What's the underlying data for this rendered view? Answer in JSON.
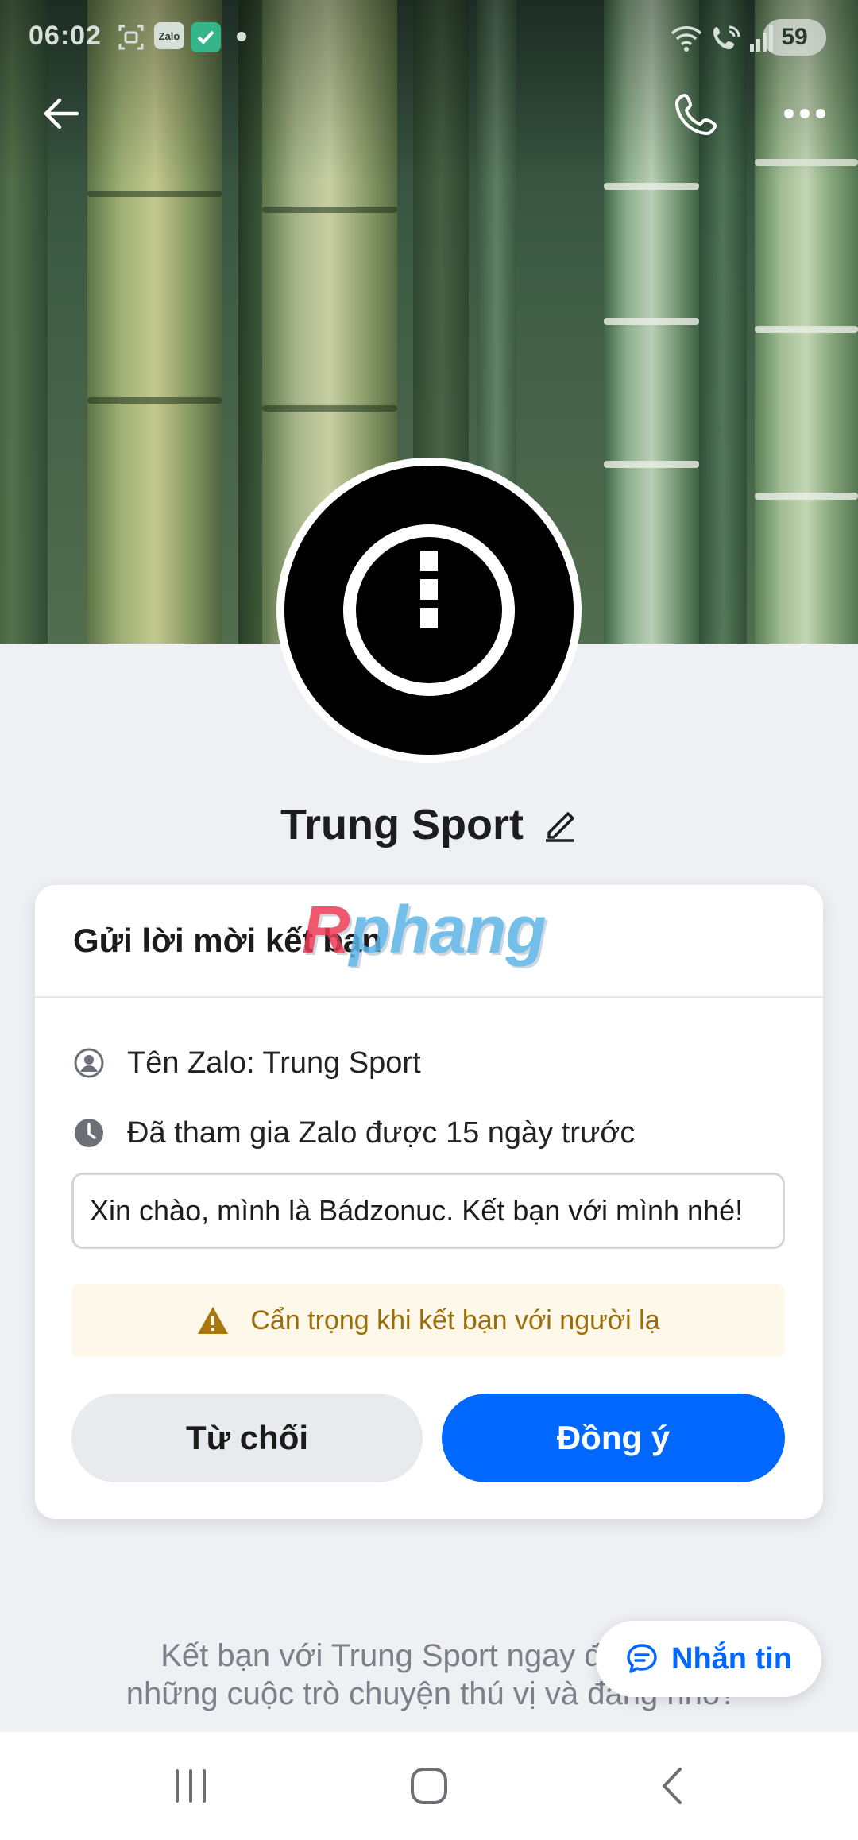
{
  "status_bar": {
    "time": "06:02",
    "battery": "59",
    "notification_icons": [
      "screenshot-icon",
      "zalo-icon",
      "check-app-icon",
      "dot-icon"
    ],
    "system_icons": [
      "wifi-icon",
      "wifi-call-icon",
      "signal-icon"
    ]
  },
  "header": {
    "back_icon": "arrow-left-icon",
    "call_icon": "phone-icon",
    "more_icon": "more-horizontal-icon"
  },
  "profile": {
    "name": "Trung Sport",
    "edit_icon": "pencil-icon"
  },
  "card": {
    "title": "Gửi lời mời kết bạn",
    "watermark_first": "R",
    "watermark_rest": "phang",
    "zalo_name": "Tên Zalo: Trung Sport",
    "joined": "Đã tham gia Zalo được 15 ngày trước",
    "message_value": "Xin chào, mình là Bádzonuc. Kết bạn với mình nhé!",
    "warning": "Cẩn trọng khi kết bạn với người lạ",
    "decline_label": "Từ chối",
    "accept_label": "Đồng ý"
  },
  "footer": {
    "line1": "Kết bạn với Trung Sport ngay để cùng",
    "line2": "những cuộc trò chuyện thú vị và đáng nhớ!",
    "chat_label": "Nhắn tin"
  },
  "colors": {
    "accent": "#0068ff",
    "warning_bg": "#fdf8ea",
    "warning_text": "#9a6c0a",
    "page_bg": "#eff0f4"
  }
}
